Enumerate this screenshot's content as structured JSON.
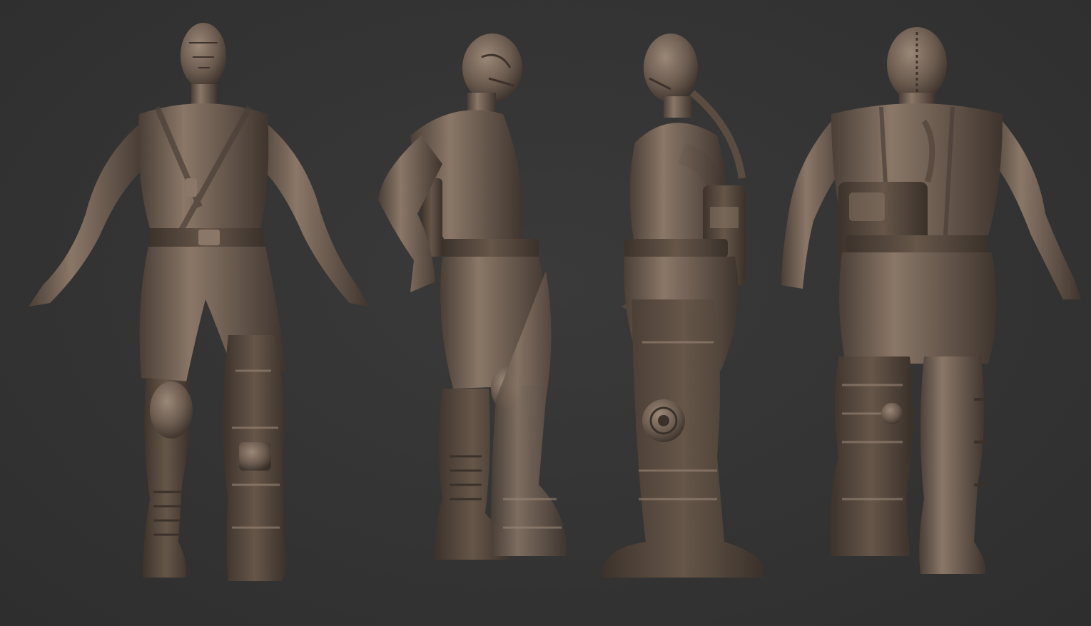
{
  "scene": {
    "background_color": "#343434",
    "material_color": "#6e5e52",
    "material_highlight": "#9a8777",
    "material_shadow": "#3d332c",
    "views": [
      {
        "name": "front-view"
      },
      {
        "name": "three-quarter-view"
      },
      {
        "name": "side-view"
      },
      {
        "name": "back-view"
      }
    ]
  }
}
